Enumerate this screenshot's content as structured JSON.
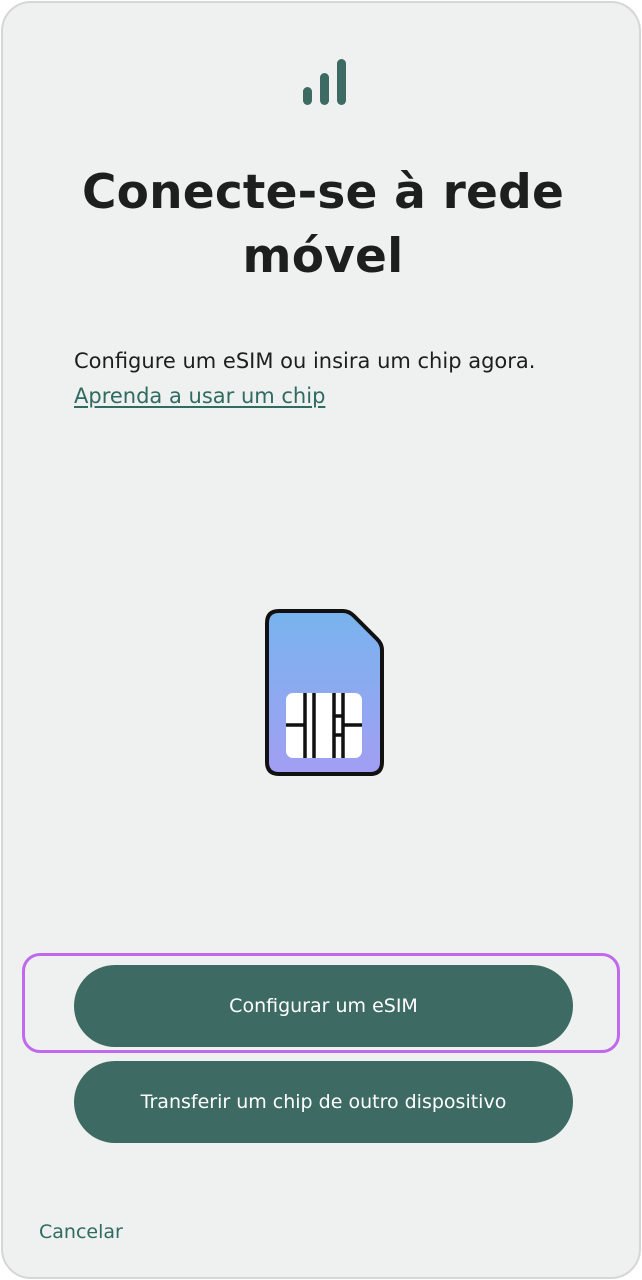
{
  "screen": {
    "title": "Conecte-se à rede móvel",
    "description": "Configure um eSIM ou insira um chip agora.",
    "learn_link": "Aprenda a usar um chip"
  },
  "icons": {
    "header": "signal-bars-icon",
    "illustration": "sim-card-icon"
  },
  "actions": {
    "setup_esim": "Configurar um eSIM",
    "transfer_chip": "Transferir um chip de outro dispositivo",
    "cancel": "Cancelar"
  },
  "colors": {
    "background": "#eff0f0",
    "primary_button": "#3d6b63",
    "link": "#2f6b60",
    "highlight": "#c169ec",
    "text": "#1c1f1e"
  }
}
